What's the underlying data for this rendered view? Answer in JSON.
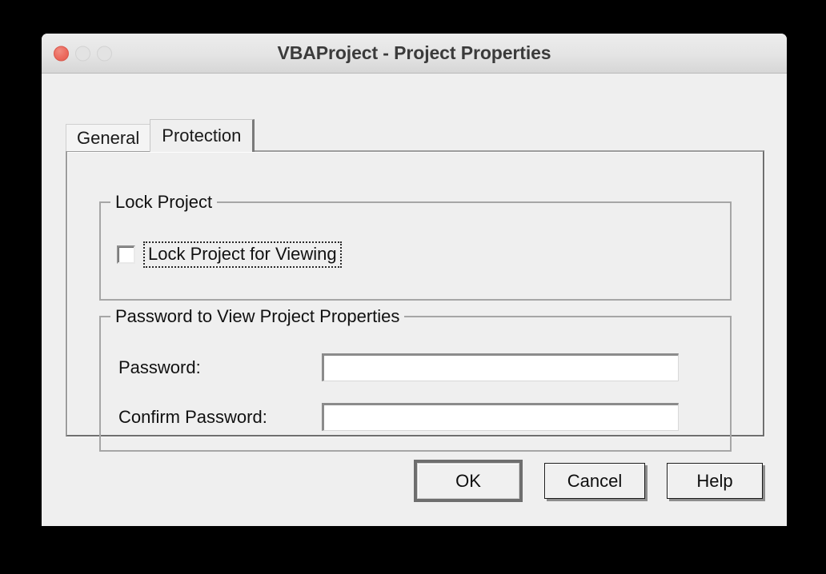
{
  "window": {
    "title": "VBAProject - Project Properties",
    "traffic_lights": [
      {
        "name": "close",
        "state": "active",
        "color": "#ec6a5e"
      },
      {
        "name": "minimize",
        "state": "disabled",
        "color": "#e3e3e3"
      },
      {
        "name": "maximize",
        "state": "disabled",
        "color": "#e3e3e3"
      }
    ]
  },
  "tabs": [
    {
      "label": "General",
      "selected": false
    },
    {
      "label": "Protection",
      "selected": true
    }
  ],
  "protection_tab": {
    "lock_group": {
      "legend": "Lock Project",
      "checkbox": {
        "label": "Lock Project for Viewing",
        "checked": false,
        "focused": true
      }
    },
    "password_group": {
      "legend": "Password to View Project Properties",
      "fields": [
        {
          "label": "Password:",
          "value": "",
          "placeholder": "",
          "type": "password"
        },
        {
          "label": "Confirm Password:",
          "value": "",
          "placeholder": "",
          "type": "password"
        }
      ]
    }
  },
  "buttons": {
    "ok": "OK",
    "cancel": "Cancel",
    "help": "Help",
    "default": "OK"
  },
  "colors": {
    "window_background": "#efefef",
    "titlebar_top": "#ededed",
    "titlebar_bottom": "#d6d6d6",
    "text": "#111111",
    "title_text": "#3b3b3b",
    "group_border": "#a6a6a6",
    "field_background": "#ffffff",
    "default_button_ring": "#6e6e6e",
    "desktop": "#000000"
  }
}
